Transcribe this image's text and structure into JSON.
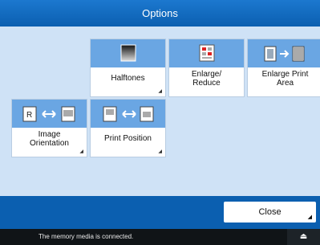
{
  "window": {
    "title": "Options"
  },
  "tiles": [
    {
      "label": "Halftones",
      "icon": "halftone-icon"
    },
    {
      "label": "Enlarge/\nReduce",
      "icon": "enlarge-reduce-icon"
    },
    {
      "label": "Enlarge Print\nArea",
      "icon": "enlarge-print-area-icon"
    },
    {
      "label": "Image\nOrientation",
      "icon": "image-orientation-icon"
    },
    {
      "label": "Print Position",
      "icon": "print-position-icon"
    }
  ],
  "buttons": {
    "close_label": "Close"
  },
  "status": {
    "message": "The memory media is connected.",
    "eject_icon": "eject-icon"
  }
}
